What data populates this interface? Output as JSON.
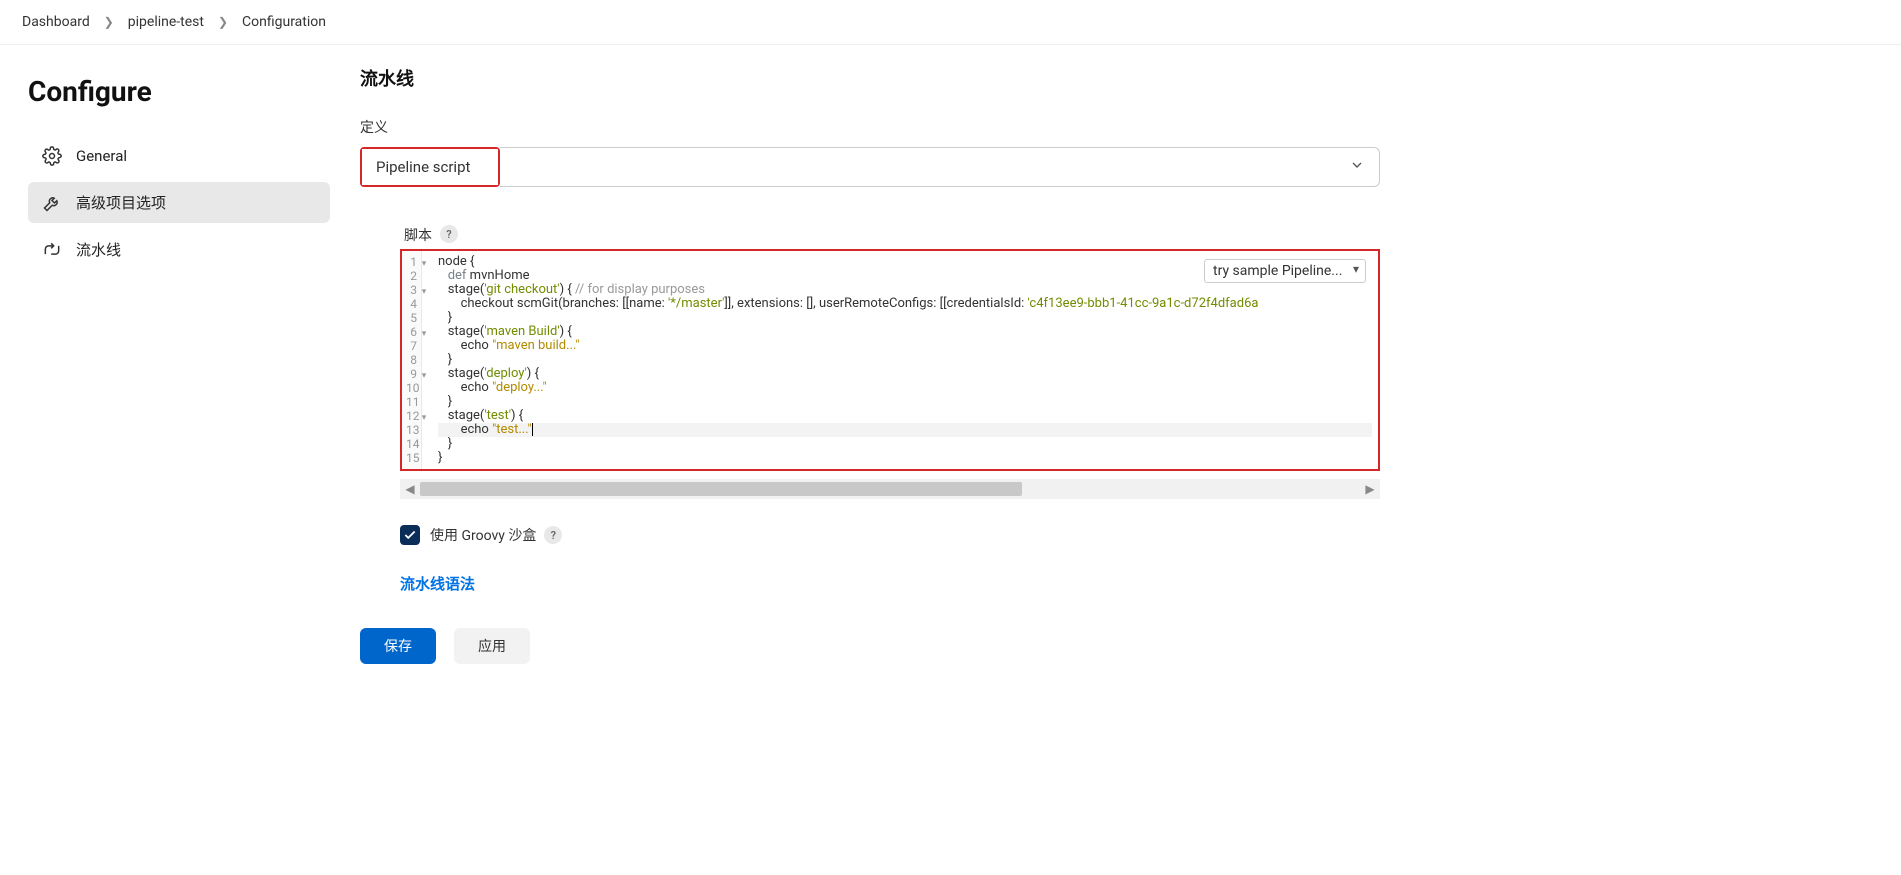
{
  "breadcrumb": {
    "items": [
      "Dashboard",
      "pipeline-test",
      "Configuration"
    ]
  },
  "sidebar": {
    "title": "Configure",
    "items": [
      {
        "label": "General",
        "icon": "gear"
      },
      {
        "label": "高级项目选项",
        "icon": "wrench"
      },
      {
        "label": "流水线",
        "icon": "pipeline"
      }
    ],
    "activeIndex": 1
  },
  "main": {
    "sectionTitle": "流水线",
    "definitionLabel": "定义",
    "definitionSelectValue": "Pipeline script",
    "scriptLabel": "脚本",
    "help": "?",
    "trySampleLabel": "try sample Pipeline...",
    "code": {
      "lineNumbers": [
        "1",
        "2",
        "3",
        "4",
        "5",
        "6",
        "7",
        "8",
        "9",
        "10",
        "11",
        "12",
        "13",
        "14",
        "15"
      ],
      "foldLines": [
        0,
        2,
        5,
        8,
        11
      ],
      "activeLine": 12,
      "raw": "node {\n   def mvnHome\n   stage('git checkout') { // for display purposes\n       checkout scmGit(branches: [[name: '*/master']], extensions: [], userRemoteConfigs: [[credentialsId: 'c4f13ee9-bbb1-41cc-9a1c-d72f4dfad6a\n   }\n   stage('maven Build') {\n       echo \"maven build...\"\n   }\n   stage('deploy') {\n       echo \"deploy...\"\n   }\n   stage('test') {\n       echo \"test...\"\n   }\n}",
      "tokens": [
        [
          {
            "t": "node ",
            "c": "ident"
          },
          {
            "t": "{",
            "c": "brace"
          }
        ],
        [
          {
            "t": "   ",
            "c": ""
          },
          {
            "t": "def",
            "c": "kw"
          },
          {
            "t": " mvnHome",
            "c": "ident"
          }
        ],
        [
          {
            "t": "   ",
            "c": ""
          },
          {
            "t": "stage",
            "c": "fn"
          },
          {
            "t": "(",
            "c": "paren"
          },
          {
            "t": "'git checkout'",
            "c": "str"
          },
          {
            "t": ") ",
            "c": "paren"
          },
          {
            "t": "{ ",
            "c": "brace"
          },
          {
            "t": "// for display purposes",
            "c": "comment"
          }
        ],
        [
          {
            "t": "       checkout scmGit",
            "c": "ident"
          },
          {
            "t": "(",
            "c": "paren"
          },
          {
            "t": "branches: ",
            "c": "prop"
          },
          {
            "t": "[[",
            "c": "paren"
          },
          {
            "t": "name: ",
            "c": "prop"
          },
          {
            "t": "'*/master'",
            "c": "str"
          },
          {
            "t": "]], ",
            "c": "paren"
          },
          {
            "t": "extensions: ",
            "c": "prop"
          },
          {
            "t": "[], ",
            "c": "paren"
          },
          {
            "t": "userRemoteConfigs: ",
            "c": "prop"
          },
          {
            "t": "[[",
            "c": "paren"
          },
          {
            "t": "credentialsId: ",
            "c": "prop"
          },
          {
            "t": "'c4f13ee9-bbb1-41cc-9a1c-d72f4dfad6a",
            "c": "str"
          }
        ],
        [
          {
            "t": "   ",
            "c": ""
          },
          {
            "t": "}",
            "c": "brace"
          }
        ],
        [
          {
            "t": "   ",
            "c": ""
          },
          {
            "t": "stage",
            "c": "fn"
          },
          {
            "t": "(",
            "c": "paren"
          },
          {
            "t": "'maven Build'",
            "c": "str"
          },
          {
            "t": ") ",
            "c": "paren"
          },
          {
            "t": "{",
            "c": "brace"
          }
        ],
        [
          {
            "t": "       echo ",
            "c": "ident"
          },
          {
            "t": "\"maven build...\"",
            "c": "str2"
          }
        ],
        [
          {
            "t": "   ",
            "c": ""
          },
          {
            "t": "}",
            "c": "brace"
          }
        ],
        [
          {
            "t": "   ",
            "c": ""
          },
          {
            "t": "stage",
            "c": "fn"
          },
          {
            "t": "(",
            "c": "paren"
          },
          {
            "t": "'deploy'",
            "c": "str"
          },
          {
            "t": ") ",
            "c": "paren"
          },
          {
            "t": "{",
            "c": "brace"
          }
        ],
        [
          {
            "t": "       echo ",
            "c": "ident"
          },
          {
            "t": "\"deploy...\"",
            "c": "str2"
          }
        ],
        [
          {
            "t": "   ",
            "c": ""
          },
          {
            "t": "}",
            "c": "brace"
          }
        ],
        [
          {
            "t": "   ",
            "c": ""
          },
          {
            "t": "stage",
            "c": "fn"
          },
          {
            "t": "(",
            "c": "paren"
          },
          {
            "t": "'test'",
            "c": "str"
          },
          {
            "t": ") ",
            "c": "paren"
          },
          {
            "t": "{",
            "c": "brace"
          }
        ],
        [
          {
            "t": "       echo ",
            "c": "ident"
          },
          {
            "t": "\"test...\"",
            "c": "str2"
          }
        ],
        [
          {
            "t": "   ",
            "c": ""
          },
          {
            "t": "}",
            "c": "brace"
          }
        ],
        [
          {
            "t": "}",
            "c": "brace"
          }
        ]
      ]
    },
    "sandboxCheckboxLabel": "使用 Groovy 沙盒",
    "pipelineSyntaxLink": "流水线语法",
    "buttons": {
      "save": "保存",
      "apply": "应用"
    }
  }
}
